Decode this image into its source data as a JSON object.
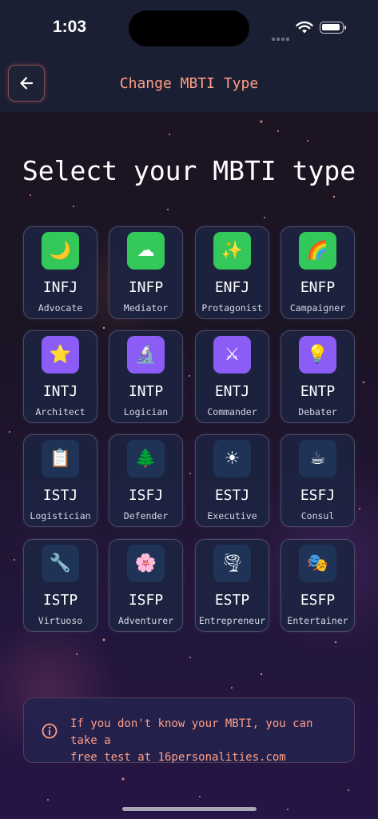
{
  "status_bar": {
    "time": "1:03"
  },
  "nav": {
    "title": "Change MBTI Type"
  },
  "heading": "Select your MBTI type",
  "types": [
    {
      "code": "INFJ",
      "name": "Advocate",
      "emoji": "🌙",
      "group": "green"
    },
    {
      "code": "INFP",
      "name": "Mediator",
      "emoji": "☁",
      "group": "green"
    },
    {
      "code": "ENFJ",
      "name": "Protagonist",
      "emoji": "✨",
      "group": "green"
    },
    {
      "code": "ENFP",
      "name": "Campaigner",
      "emoji": "🌈",
      "group": "green"
    },
    {
      "code": "INTJ",
      "name": "Architect",
      "emoji": "⭐",
      "group": "purple"
    },
    {
      "code": "INTP",
      "name": "Logician",
      "emoji": "🔬",
      "group": "purple"
    },
    {
      "code": "ENTJ",
      "name": "Commander",
      "emoji": "⚔",
      "group": "purple"
    },
    {
      "code": "ENTP",
      "name": "Debater",
      "emoji": "💡",
      "group": "purple"
    },
    {
      "code": "ISTJ",
      "name": "Logistician",
      "emoji": "📋",
      "group": "blue"
    },
    {
      "code": "ISFJ",
      "name": "Defender",
      "emoji": "🌲",
      "group": "blue"
    },
    {
      "code": "ESTJ",
      "name": "Executive",
      "emoji": "☀",
      "group": "blue"
    },
    {
      "code": "ESFJ",
      "name": "Consul",
      "emoji": "☕",
      "group": "blue"
    },
    {
      "code": "ISTP",
      "name": "Virtuoso",
      "emoji": "🔧",
      "group": "blue"
    },
    {
      "code": "ISFP",
      "name": "Adventurer",
      "emoji": "🌸",
      "group": "blue"
    },
    {
      "code": "ESTP",
      "name": "Entrepreneur",
      "emoji": "🌪",
      "group": "blue"
    },
    {
      "code": "ESFP",
      "name": "Entertainer",
      "emoji": "🎭",
      "group": "blue"
    }
  ],
  "colors": {
    "green": "#34c759",
    "purple": "#8b5cf6",
    "blue": "#1f3357",
    "accent": "#ff9e85"
  },
  "info": {
    "line1": "If you don't know your MBTI, you can take a",
    "line2": "free test at 16personalities.com"
  }
}
